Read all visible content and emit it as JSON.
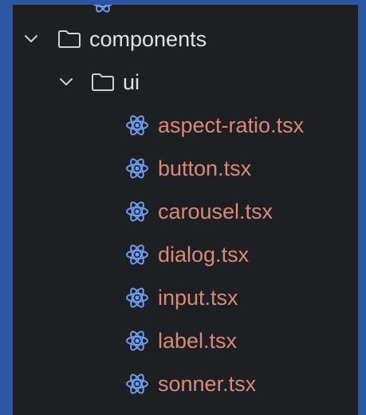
{
  "tree": {
    "folders": [
      {
        "label": "components",
        "expanded": true
      },
      {
        "label": "ui",
        "expanded": true
      }
    ],
    "files": [
      {
        "label": "aspect-ratio.tsx",
        "icon": "react-icon"
      },
      {
        "label": "button.tsx",
        "icon": "react-icon"
      },
      {
        "label": "carousel.tsx",
        "icon": "react-icon"
      },
      {
        "label": "dialog.tsx",
        "icon": "react-icon"
      },
      {
        "label": "input.tsx",
        "icon": "react-icon"
      },
      {
        "label": "label.tsx",
        "icon": "react-icon"
      },
      {
        "label": "sonner.tsx",
        "icon": "react-icon"
      }
    ]
  },
  "colors": {
    "background": "#1e1f22",
    "frame": "#2a56a5",
    "folder_text": "#dfe1e5",
    "file_text": "#d9897a",
    "react_icon": "#6f9df0",
    "icon_gray": "#ced0d6"
  }
}
